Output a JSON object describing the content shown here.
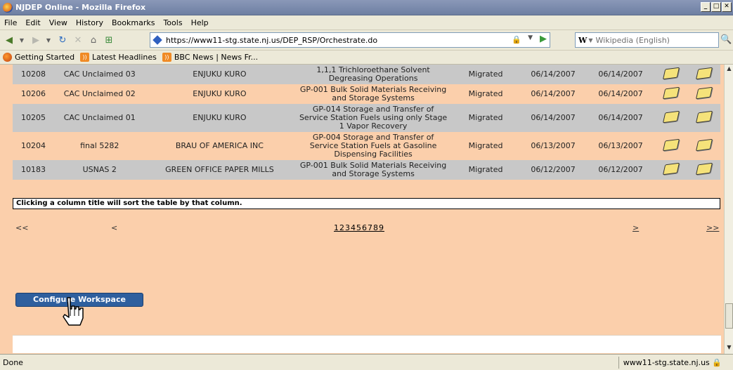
{
  "window": {
    "title": "NJDEP Online - Mozilla Firefox"
  },
  "menu": [
    "File",
    "Edit",
    "View",
    "History",
    "Bookmarks",
    "Tools",
    "Help"
  ],
  "nav": {
    "url": "https://www11-stg.state.nj.us/DEP_RSP/Orchestrate.do",
    "search_engine": "W",
    "search_placeholder": "Wikipedia (English)"
  },
  "bookmarks": [
    "Getting Started",
    "Latest Headlines",
    "BBC News | News Fr..."
  ],
  "table": {
    "rows": [
      {
        "id": "10208",
        "name": "CAC Unclaimed 03",
        "company": "ENJUKU KURO",
        "permit": "1,1,1 Trichloroethane Solvent Degreasing Operations",
        "status": "Migrated",
        "date1": "06/14/2007",
        "date2": "06/14/2007",
        "style": "gray"
      },
      {
        "id": "10206",
        "name": "CAC Unclaimed 02",
        "company": "ENJUKU KURO",
        "permit": "GP-001 Bulk Solid Materials Receiving and Storage Systems",
        "status": "Migrated",
        "date1": "06/14/2007",
        "date2": "06/14/2007",
        "style": "peach"
      },
      {
        "id": "10205",
        "name": "CAC Unclaimed 01",
        "company": "ENJUKU KURO",
        "permit": "GP-014 Storage and Transfer of Service Station Fuels using only Stage 1 Vapor Recovery",
        "status": "Migrated",
        "date1": "06/14/2007",
        "date2": "06/14/2007",
        "style": "gray"
      },
      {
        "id": "10204",
        "name": "final 5282",
        "company": "BRAU OF AMERICA INC",
        "permit": "GP-004 Storage and Transfer of Service Station Fuels at Gasoline Dispensing Facilities",
        "status": "Migrated",
        "date1": "06/13/2007",
        "date2": "06/13/2007",
        "style": "peach"
      },
      {
        "id": "10183",
        "name": "USNAS 2",
        "company": "GREEN OFFICE PAPER MILLS",
        "permit": "GP-001 Bulk Solid Materials Receiving and Storage Systems",
        "status": "Migrated",
        "date1": "06/12/2007",
        "date2": "06/12/2007",
        "style": "gray"
      }
    ],
    "hint": "Clicking a column title will sort the table by that column."
  },
  "pager": {
    "first": "<<",
    "prev": "<",
    "pages": [
      "1",
      "2",
      "3",
      "4",
      "5",
      "6",
      "7",
      "8",
      "9"
    ],
    "next": ">",
    "last": ">>"
  },
  "configure_button": "Configure Workspace",
  "status": {
    "left": "Done",
    "right": "www11-stg.state.nj.us"
  }
}
